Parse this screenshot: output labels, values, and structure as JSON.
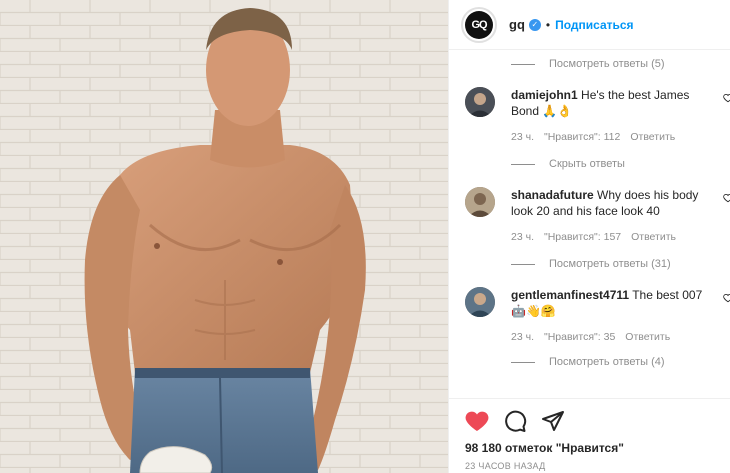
{
  "header": {
    "logo_text": "GQ",
    "username": "gq",
    "separator": "•",
    "follow_label": "Подписаться"
  },
  "comments": {
    "view_replies_top": "Посмотреть ответы (5)",
    "items": [
      {
        "username": "damiejohn1",
        "text": "He's the best James Bond 🙏👌",
        "time": "23 ч.",
        "likes": "\"Нравится\": 112",
        "reply": "Ответить",
        "replies_toggle": "Скрыть ответы"
      },
      {
        "username": "shanadafuture",
        "text": "Why does his body look 20 and his face look 40",
        "time": "23 ч.",
        "likes": "\"Нравится\": 157",
        "reply": "Ответить",
        "replies_toggle": "Посмотреть ответы (31)"
      },
      {
        "username": "gentlemanfinest4711",
        "text": "The best 007 🤖👋🤗",
        "time": "23 ч.",
        "likes": "\"Нравится\": 35",
        "reply": "Ответить",
        "replies_toggle": "Посмотреть ответы (4)"
      }
    ]
  },
  "actions": {
    "like_icon": "heart-icon",
    "comment_icon": "comment-icon",
    "share_icon": "share-icon",
    "likes_count": "98 180 отметок \"Нравится\"",
    "timestamp": "23 ЧАСОВ НАЗАД"
  },
  "colors": {
    "accent": "#0095f6",
    "liked": "#ed4956",
    "verified": "#3897f0",
    "muted": "#8e8e8e"
  }
}
